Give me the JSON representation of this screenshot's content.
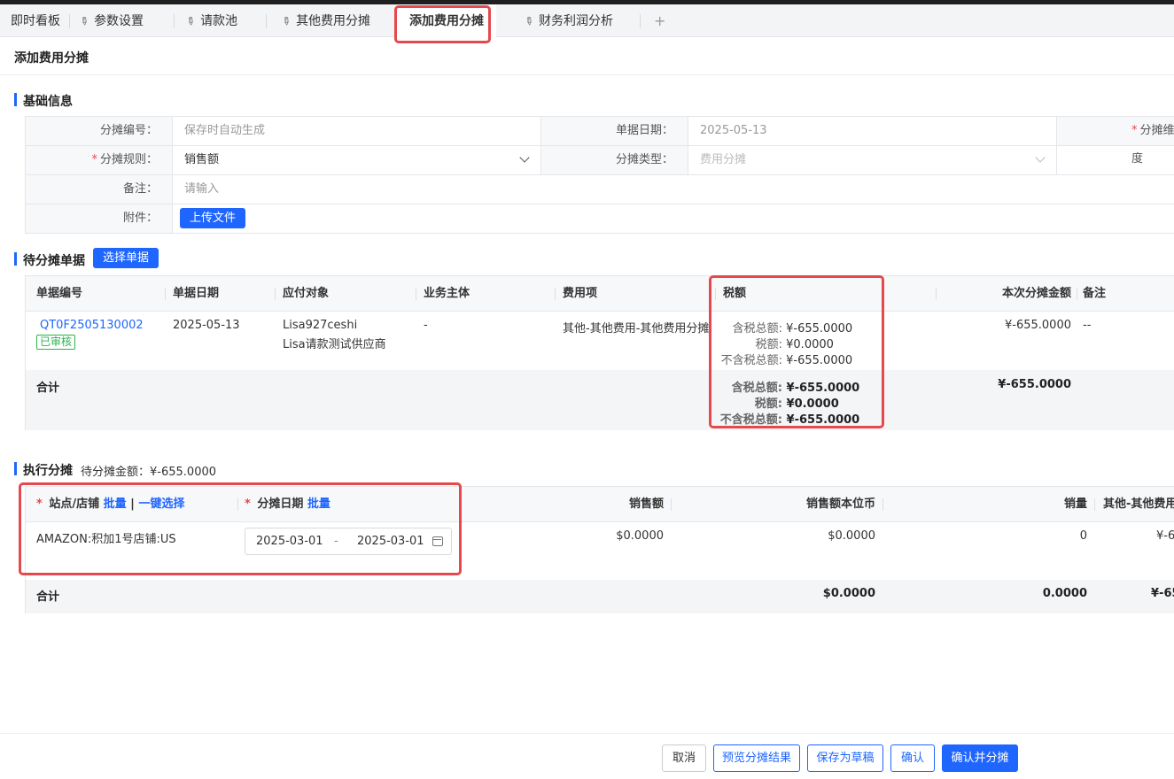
{
  "tabs": [
    {
      "label": "即时看板",
      "pinned": false,
      "active": false
    },
    {
      "label": "参数设置",
      "pinned": true,
      "active": false
    },
    {
      "label": "请款池",
      "pinned": true,
      "active": false
    },
    {
      "label": "其他费用分摊",
      "pinned": true,
      "active": false
    },
    {
      "label": "添加费用分摊",
      "pinned": false,
      "active": true
    },
    {
      "label": "财务利润分析",
      "pinned": true,
      "active": false
    }
  ],
  "tab_add_icon": "+",
  "page_title": "添加费用分摊",
  "basic": {
    "title": "基础信息",
    "no_label": "分摊编号：",
    "no_value": "保存时自动生成",
    "date_label": "单据日期：",
    "date_value": "2025-05-13",
    "dim_label": "分摊维度",
    "rule_label": "分摊规则：",
    "rule_value": "销售额",
    "type_label": "分摊类型：",
    "type_value": "费用分摊",
    "remark_label": "备注：",
    "remark_placeholder": "请输入",
    "attach_label": "附件：",
    "upload_button": "上传文件"
  },
  "pending": {
    "title": "待分摊单据",
    "select_button": "选择单据",
    "headers": {
      "doc_no": "单据编号",
      "doc_date": "单据日期",
      "payee": "应付对象",
      "entity": "业务主体",
      "expense": "费用项",
      "tax": "税额",
      "amount": "本次分摊金额",
      "remark": "备注"
    },
    "rows": [
      {
        "doc_no": "QT0F2505130002",
        "status": "已审核",
        "doc_date": "2025-05-13",
        "payee_line1": "Lisa927ceshi",
        "payee_line2": "Lisa请款测试供应商",
        "entity": "-",
        "expense": "其他-其他费用-其他费用分摊...",
        "tax_incl_label": "含税总额:",
        "tax_incl": "¥-655.0000",
        "tax_label": "税额:",
        "tax": "¥0.0000",
        "tax_excl_label": "不含税总额:",
        "tax_excl": "¥-655.0000",
        "amount": "¥-655.0000",
        "remark": "--"
      }
    ],
    "total": {
      "label": "合计",
      "tax_incl_label": "含税总额:",
      "tax_incl": "¥-655.0000",
      "tax_label": "税额:",
      "tax": "¥0.0000",
      "tax_excl_label": "不含税总额:",
      "tax_excl": "¥-655.0000",
      "amount": "¥-655.0000"
    }
  },
  "execute": {
    "title": "执行分摊",
    "pending_label": "待分摊金额：",
    "pending_value": "¥-655.0000",
    "headers": {
      "store": "站点/店铺",
      "batch": "批量",
      "pipe": "|",
      "one_click": "一键选择",
      "date": "分摊日期",
      "date_batch": "批量",
      "sales": "销售额",
      "sales_base": "销售额本位币",
      "qty": "销量",
      "other": "其他-其他费用-"
    },
    "rows": [
      {
        "store": "AMAZON:积加1号店铺:US",
        "date_start": "2025-03-01",
        "date_sep": "-",
        "date_end": "2025-03-01",
        "sales": "$0.0000",
        "sales_base": "$0.0000",
        "qty": "0",
        "other": "¥-6"
      }
    ],
    "total": {
      "label": "合计",
      "sales_base": "$0.0000",
      "qty": "0.0000",
      "other": "¥-65"
    }
  },
  "footer": {
    "cancel": "取消",
    "preview": "预览分摊结果",
    "save_draft": "保存为草稿",
    "confirm": "确认",
    "confirm_split": "确认并分摊"
  },
  "colors": {
    "primary": "#1f66ff",
    "highlight": "#e5484d",
    "approved": "#2bb24c"
  }
}
